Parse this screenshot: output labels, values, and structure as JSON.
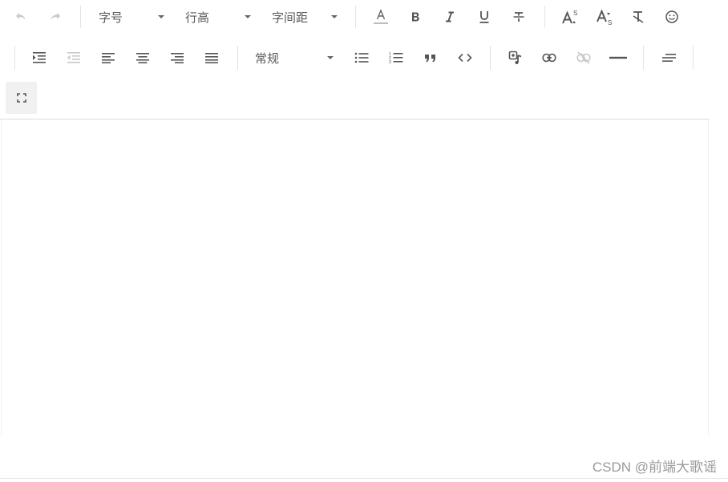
{
  "toolbar": {
    "font_size_label": "字号",
    "line_height_label": "行高",
    "letter_spacing_label": "字间距",
    "header_value": "常规"
  },
  "watermark": "CSDN @前端大歌谣",
  "colors": {
    "icon": "#555555",
    "disabled": "#b5b5b5",
    "separator": "#e4e4e4",
    "fullscreen_bg": "#f1f1f1"
  },
  "icons": [
    "undo-icon",
    "redo-icon",
    "font-color-icon",
    "bold-icon",
    "italic-icon",
    "underline-icon",
    "strikethrough-icon",
    "superscript-icon",
    "subscript-icon",
    "clear-format-icon",
    "emoji-icon",
    "indent-icon",
    "outdent-icon",
    "align-left-icon",
    "align-center-icon",
    "align-right-icon",
    "align-justify-icon",
    "bulleted-list-icon",
    "numbered-list-icon",
    "blockquote-icon",
    "code-icon",
    "media-icon",
    "link-icon",
    "unlink-icon",
    "horizontal-rule-icon",
    "text-indent-icon",
    "fullscreen-icon"
  ]
}
